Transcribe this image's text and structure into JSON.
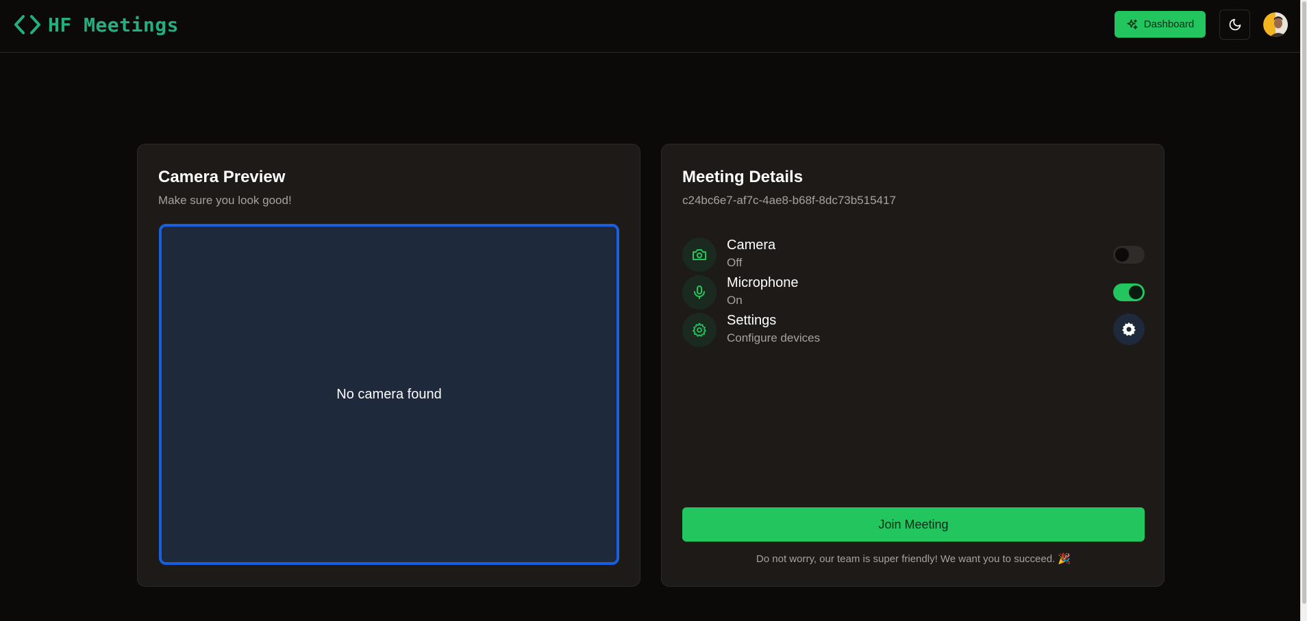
{
  "header": {
    "brand": "HF Meetings",
    "dashboard_label": "Dashboard"
  },
  "camera_card": {
    "title": "Camera Preview",
    "subtitle": "Make sure you look good!",
    "preview_message": "No camera found"
  },
  "meeting_card": {
    "title": "Meeting Details",
    "meeting_id": "c24bc6e7-af7c-4ae8-b68f-8dc73b515417",
    "camera": {
      "label": "Camera",
      "state": "Off",
      "enabled": false
    },
    "microphone": {
      "label": "Microphone",
      "state": "On",
      "enabled": true
    },
    "settings": {
      "label": "Settings",
      "description": "Configure devices"
    },
    "join_label": "Join Meeting",
    "footnote": "Do not worry, our team is super friendly! We want you to succeed. 🎉"
  },
  "colors": {
    "accent": "#22c55e",
    "brand": "#22b07d",
    "preview_border": "#1a5fe0",
    "preview_bg": "#1e293b",
    "card_bg": "#1d1a17",
    "page_bg": "#0b0a09"
  },
  "icons": [
    "code-brackets-icon",
    "sparkles-icon",
    "moon-icon",
    "camera-icon",
    "microphone-icon",
    "gear-icon"
  ]
}
